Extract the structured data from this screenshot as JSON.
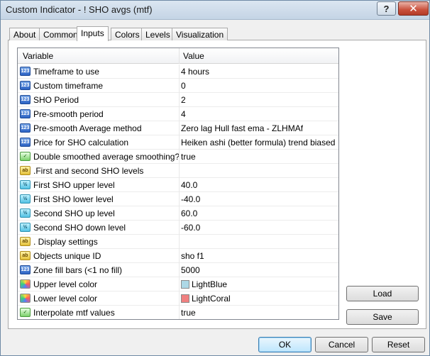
{
  "window": {
    "title": "Custom Indicator - ! SHO avgs (mtf)",
    "help_label": "?",
    "close_label": "✕"
  },
  "tabs": [
    {
      "label": "About"
    },
    {
      "label": "Common"
    },
    {
      "label": "Inputs"
    },
    {
      "label": "Colors"
    },
    {
      "label": "Levels"
    },
    {
      "label": "Visualization"
    }
  ],
  "active_tab": "Inputs",
  "grid": {
    "header_variable": "Variable",
    "header_value": "Value",
    "rows": [
      {
        "icon": "int",
        "name": "Timeframe to use",
        "value": "4 hours"
      },
      {
        "icon": "int",
        "name": "Custom timeframe",
        "value": "0"
      },
      {
        "icon": "int",
        "name": "SHO Period",
        "value": "2"
      },
      {
        "icon": "int",
        "name": "Pre-smooth period",
        "value": "4"
      },
      {
        "icon": "int",
        "name": "Pre-smooth Average method",
        "value": "Zero lag Hull fast ema - ZLHMAf"
      },
      {
        "icon": "int",
        "name": "Price for SHO calculation",
        "value": "Heiken ashi (better formula) trend biased (ext..."
      },
      {
        "icon": "bool",
        "name": "Double smoothed average smoothing?",
        "value": "true"
      },
      {
        "icon": "str",
        "name": ".First and second SHO levels",
        "value": ""
      },
      {
        "icon": "dbl",
        "name": "First SHO upper level",
        "value": "40.0"
      },
      {
        "icon": "dbl",
        "name": "First SHO lower level",
        "value": "-40.0"
      },
      {
        "icon": "dbl",
        "name": "Second SHO up level",
        "value": "60.0"
      },
      {
        "icon": "dbl",
        "name": "Second SHO down level",
        "value": "-60.0"
      },
      {
        "icon": "str",
        "name": ". Display settings",
        "value": ""
      },
      {
        "icon": "str",
        "name": "Objects unique ID",
        "value": "sho f1"
      },
      {
        "icon": "int",
        "name": "Zone fill bars (<1 no fill)",
        "value": "5000"
      },
      {
        "icon": "color",
        "name": "Upper level color",
        "value": "LightBlue",
        "swatch": "#add8e6"
      },
      {
        "icon": "color",
        "name": "Lower level color",
        "value": "LightCoral",
        "swatch": "#f08080"
      },
      {
        "icon": "bool",
        "name": "Interpolate mtf values",
        "value": "true"
      }
    ]
  },
  "icon_labels": {
    "int": "123",
    "str": "ab",
    "dbl": "½",
    "bool": "✓",
    "color": ""
  },
  "buttons": {
    "load": "Load",
    "save": "Save",
    "ok": "OK",
    "cancel": "Cancel",
    "reset": "Reset"
  }
}
